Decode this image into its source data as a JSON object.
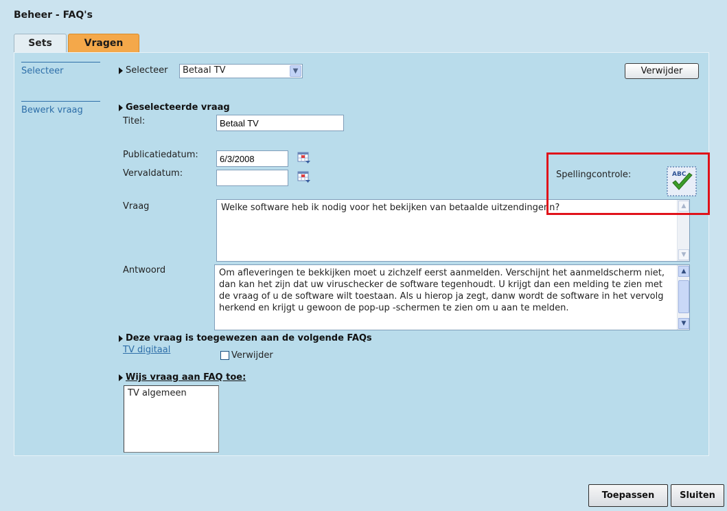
{
  "window": {
    "title": "Beheer - FAQ's"
  },
  "tabs": [
    {
      "label": "Sets",
      "active": false
    },
    {
      "label": "Vragen",
      "active": true
    }
  ],
  "sidenav": {
    "select": "Selecteer",
    "edit": "Bewerk vraag"
  },
  "select_row": {
    "label": "Selecteer",
    "value": "Betaal TV",
    "delete_button": "Verwijder"
  },
  "question": {
    "heading": "Geselecteerde vraag",
    "title_label": "Titel:",
    "title_value": "Betaal TV",
    "pub_label": "Publicatiedatum:",
    "pub_value": "6/3/2008",
    "exp_label": "Vervaldatum:",
    "exp_value": "",
    "vraag_label": "Vraag",
    "vraag_text": "Welke software heb ik nodig voor het bekijken van betaalde uitzendingenn?",
    "antwoord_label": "Antwoord",
    "antwoord_text": "Om afleveringen te bekkijken moet u zichzelf eerst aanmelden. Verschijnt het aanmeldscherm niet, dan kan het zijn dat uw viruschecker de software tegenhoudt. U krijgt dan een melding te zien met de vraag of u de software wilt toestaan. Als u hierop ja zegt, danw wordt de software in het vervolg herkend en krijgt u gewoon de pop-up -schermen te zien om u aan te melden."
  },
  "spellcheck": {
    "label": "Spellingcontrole:",
    "icon_text": "ABC",
    "icon": "spellcheck-icon",
    "highlight_color": "#e0121a"
  },
  "assigned": {
    "heading": "Deze vraag is toegewezen aan de volgende FAQs",
    "link": "TV digitaal",
    "checkbox_label": "Verwijder"
  },
  "assign": {
    "heading": "Wijs vraag aan FAQ toe:",
    "options": [
      "TV algemeen"
    ]
  },
  "footer": {
    "apply": "Toepassen",
    "close": "Sluiten"
  },
  "colors": {
    "accent_tab": "#f4a84a",
    "panel": "#b9dceb",
    "link": "#2d6ea8"
  }
}
